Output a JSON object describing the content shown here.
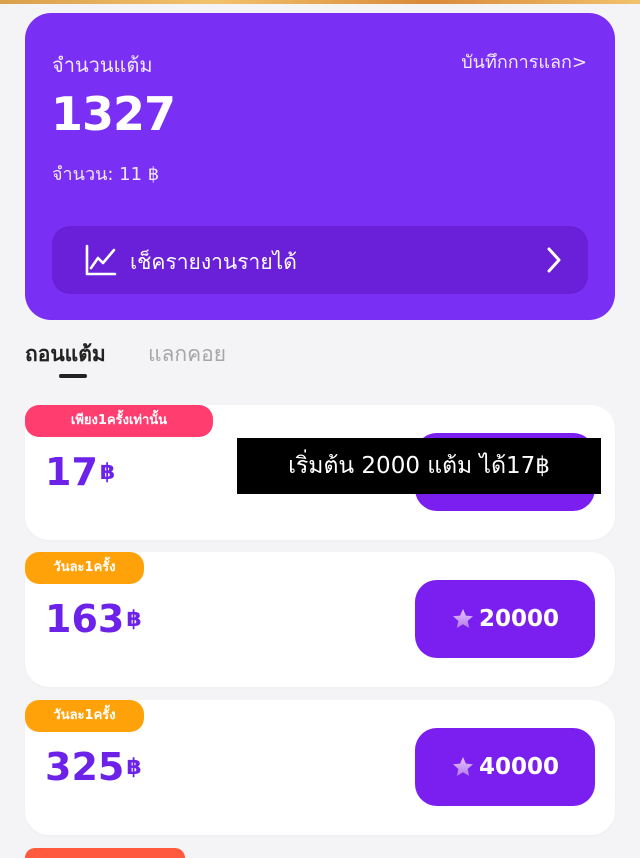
{
  "points": {
    "label": "จำนวนแต้ม",
    "history_link": "บันทึกการแลก>",
    "value": "1327",
    "amount_label": "จำนวน: 11 ฿",
    "income_report": "เช็ครายงานรายได้"
  },
  "tabs": {
    "withdraw": "ถอนแต้ม",
    "exchange": "แลกคอย"
  },
  "offers": [
    {
      "badge": "เพียง1ครั้งเท่านั้น",
      "amount": "17",
      "currency": "฿",
      "cost": ""
    },
    {
      "badge": "วันละ1ครั้ง",
      "amount": "163",
      "currency": "฿",
      "cost": "20000"
    },
    {
      "badge": "วันละ1ครั้ง",
      "amount": "325",
      "currency": "฿",
      "cost": "40000"
    }
  ],
  "caption": "เริ่มต้น 2000 แต้ม ได้17฿",
  "colors": {
    "primary": "#7a2ff5",
    "button": "#7a1ff0",
    "badge_pink": "#ff3d6e",
    "badge_orange": "#ffa20a",
    "amount_text": "#6c22e8"
  },
  "icons": {
    "income": "line-chart-icon",
    "chevron": "chevron-right-icon",
    "cost": "star-icon"
  }
}
